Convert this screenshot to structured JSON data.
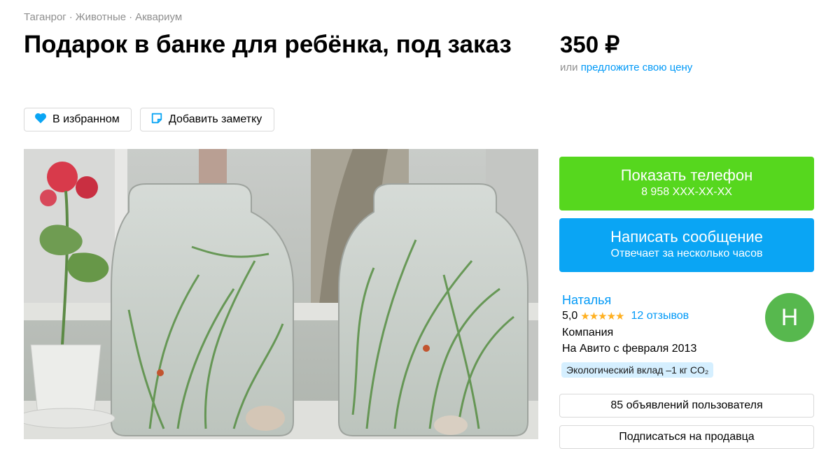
{
  "breadcrumb": {
    "items": [
      "Таганрог",
      "Животные",
      "Аквариум"
    ],
    "separator": "·"
  },
  "title": "Подарок в банке для ребёнка, под заказ",
  "price": {
    "value": "350 ₽",
    "prefix": "или",
    "suggest_link": "предложите свою цену"
  },
  "actions": {
    "favorite_label": "В избранном",
    "note_label": "Добавить заметку"
  },
  "contact": {
    "show_phone": "Показать телефон",
    "phone_masked": "8 958 XXX-XX-XX",
    "message": "Написать сообщение",
    "message_sub": "Отвечает за несколько часов"
  },
  "seller": {
    "name": "Наталья",
    "rating": "5,0",
    "stars": "★★★★★",
    "reviews": "12 отзывов",
    "type": "Компания",
    "since": "На Авито с февраля 2013",
    "eco_badge": "Экологический вклад –1 кг CO₂",
    "avatar_letter": "Н",
    "listings_button": "85 объявлений пользователя",
    "subscribe_button": "Подписаться на продавца"
  },
  "colors": {
    "green": "#56d71e",
    "blue": "#0aa5f4",
    "link": "#0099f7",
    "avatar": "#57b84e",
    "star": "#ffb021"
  },
  "icons": {
    "favorite": "heart-icon",
    "note": "sticky-note-icon"
  }
}
